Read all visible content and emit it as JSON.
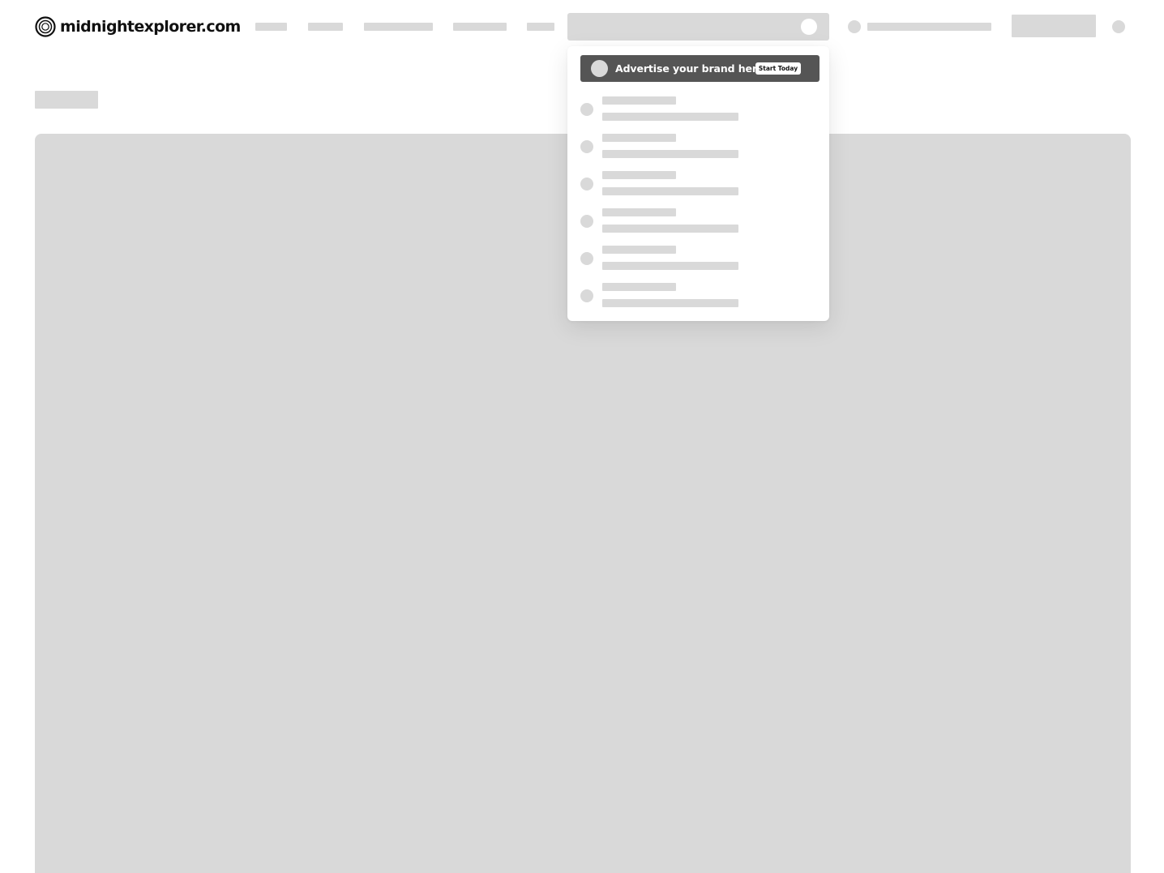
{
  "header": {
    "brand": "midnightexplorer.com",
    "logo_icon": "concentric-circles-logo-icon"
  },
  "dropdown": {
    "ad_banner": {
      "text": "Advertise your brand here",
      "button_label": "Start Today",
      "icon": "brand-placeholder-icon"
    },
    "results": [
      {
        "icon": "result-placeholder-icon"
      },
      {
        "icon": "result-placeholder-icon"
      },
      {
        "icon": "result-placeholder-icon"
      },
      {
        "icon": "result-placeholder-icon"
      },
      {
        "icon": "result-placeholder-icon"
      },
      {
        "icon": "result-placeholder-icon"
      }
    ]
  },
  "colors": {
    "placeholder": "#d9d9d9",
    "ad_background": "#555555",
    "text_dark": "#111111",
    "background": "#ffffff"
  }
}
